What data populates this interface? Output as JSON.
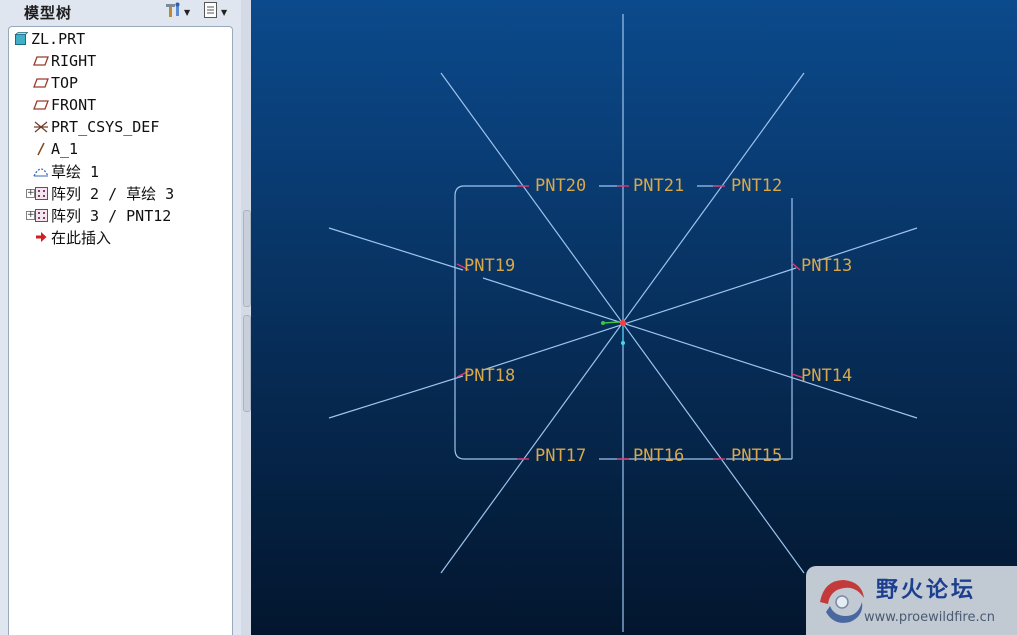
{
  "panel": {
    "title": "模型树",
    "settings_icon": "tree-settings-icon",
    "show_icon": "tree-show-icon"
  },
  "tree": {
    "items": [
      {
        "label": "ZL.PRT",
        "icon": "part-icon"
      },
      {
        "label": "RIGHT",
        "icon": "datum-plane-icon"
      },
      {
        "label": "TOP",
        "icon": "datum-plane-icon"
      },
      {
        "label": "FRONT",
        "icon": "datum-plane-icon"
      },
      {
        "label": "PRT_CSYS_DEF",
        "icon": "csys-icon"
      },
      {
        "label": "A_1",
        "icon": "datum-axis-icon"
      },
      {
        "label": "草绘 1",
        "icon": "sketch-icon"
      },
      {
        "label": "阵列 2 / 草绘 3",
        "icon": "pattern-icon"
      },
      {
        "label": "阵列 3 / PNT12",
        "icon": "pattern-icon"
      },
      {
        "label": "在此插入",
        "icon": "insert-here-icon"
      }
    ]
  },
  "viewport": {
    "points": [
      "PNT20",
      "PNT21",
      "PNT12",
      "PNT19",
      "PNT13",
      "PNT18",
      "PNT14",
      "PNT17",
      "PNT16",
      "PNT15"
    ]
  },
  "watermark": {
    "name": "野火论坛",
    "url": "www.proewildfire.cn"
  },
  "colors": {
    "line": "#9ec4ee",
    "point_label": "#d8a84a",
    "point_mark": "#e03870",
    "origin": "#ff3b3b"
  }
}
